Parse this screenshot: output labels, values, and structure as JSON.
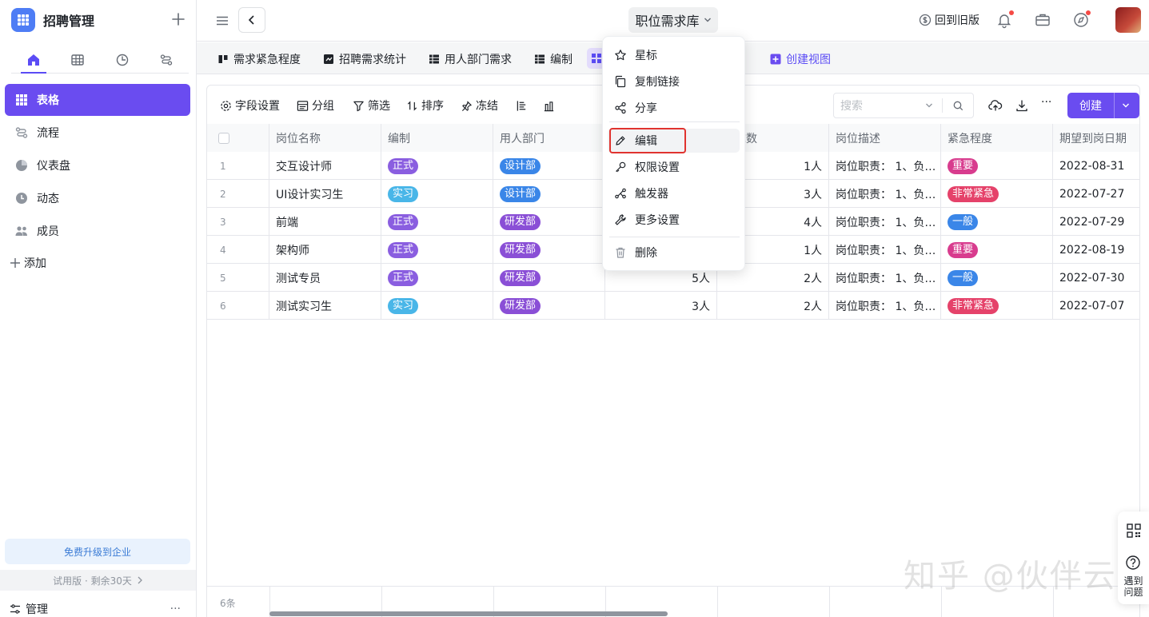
{
  "app": {
    "title": "招聘管理"
  },
  "sidebar": {
    "items": [
      {
        "label": "表格"
      },
      {
        "label": "流程"
      },
      {
        "label": "仪表盘"
      },
      {
        "label": "动态"
      },
      {
        "label": "成员"
      }
    ],
    "add_label": "添加",
    "upgrade_label": "免费升级到企业",
    "trial_label": "试用版 · 剩余30天",
    "manage_label": "管理",
    "manage_more": "···"
  },
  "topbar": {
    "title": "职位需求库",
    "back_old_label": "回到旧版"
  },
  "view_tabs": [
    {
      "label": "需求紧急程度"
    },
    {
      "label": "招聘需求统计"
    },
    {
      "label": "用人部门需求"
    },
    {
      "label": "编制"
    }
  ],
  "create_view_label": "创建视图",
  "toolbar": {
    "field_settings": "字段设置",
    "group": "分组",
    "filter": "筛选",
    "sort": "排序",
    "freeze": "冻结",
    "search_placeholder": "搜索",
    "more": "···",
    "create_label": "创建"
  },
  "table": {
    "columns": [
      "岗位名称",
      "编制",
      "用人部门",
      "",
      "需求数",
      "岗位描述",
      "紧急程度",
      "期望到岗日期"
    ],
    "rows": [
      {
        "num": "1",
        "name": "交互设计师",
        "type": "正式",
        "dept": "设计部",
        "col4": "",
        "demand": "1人",
        "desc": "岗位职责： 1、负…",
        "urgency": "重要",
        "date": "2022-08-31"
      },
      {
        "num": "2",
        "name": "UI设计实习生",
        "type": "实习",
        "dept": "设计部",
        "col4": "",
        "demand": "3人",
        "desc": "岗位职责： 1、负…",
        "urgency": "非常紧急",
        "date": "2022-07-27"
      },
      {
        "num": "3",
        "name": "前端",
        "type": "正式",
        "dept": "研发部",
        "col4": "",
        "demand": "4人",
        "desc": "岗位职责： 1、负…",
        "urgency": "一般",
        "date": "2022-07-29"
      },
      {
        "num": "4",
        "name": "架构师",
        "type": "正式",
        "dept": "研发部",
        "col4": "",
        "demand": "1人",
        "desc": "岗位职责： 1、负…",
        "urgency": "重要",
        "date": "2022-08-19"
      },
      {
        "num": "5",
        "name": "测试专员",
        "type": "正式",
        "dept": "研发部",
        "col4": "5人",
        "demand": "2人",
        "desc": "岗位职责： 1、负…",
        "urgency": "一般",
        "date": "2022-07-30"
      },
      {
        "num": "6",
        "name": "测试实习生",
        "type": "实习",
        "dept": "研发部",
        "col4": "3人",
        "demand": "2人",
        "desc": "岗位职责： 1、负…",
        "urgency": "非常紧急",
        "date": "2022-07-07"
      }
    ],
    "footer_count": "6条"
  },
  "tag_colors": {
    "正式": "#8a5ee0",
    "实习": "#49b6e8",
    "设计部": "#3a86e8",
    "研发部": "#8a4fd6",
    "重要": "#d83c8e",
    "非常紧急": "#e5426a",
    "一般": "#3a86e8"
  },
  "dropdown": {
    "items": [
      {
        "label": "星标",
        "icon": "star-icon"
      },
      {
        "label": "复制链接",
        "icon": "copy-icon"
      },
      {
        "label": "分享",
        "icon": "share-icon"
      },
      {
        "label": "编辑",
        "icon": "pencil-icon"
      },
      {
        "label": "权限设置",
        "icon": "key-icon"
      },
      {
        "label": "触发器",
        "icon": "trigger-icon"
      },
      {
        "label": "更多设置",
        "icon": "wrench-icon"
      },
      {
        "label": "删除",
        "icon": "trash-icon"
      }
    ]
  },
  "float_panel": {
    "help_label": "遇到\n问题"
  },
  "watermark": "知乎 @伙伴云"
}
